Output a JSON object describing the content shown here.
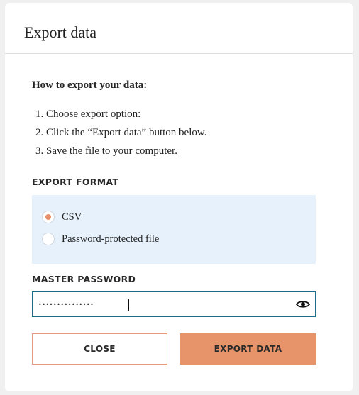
{
  "dialog": {
    "title": "Export data"
  },
  "instructions": {
    "title": "How to export your data:",
    "steps": [
      "1. Choose export option:",
      "2. Click the “Export data” button below.",
      "3. Save the file to your computer."
    ]
  },
  "export_format": {
    "label": "EXPORT FORMAT",
    "options": [
      {
        "label": "CSV",
        "checked": true
      },
      {
        "label": "Password-protected file",
        "checked": false
      }
    ]
  },
  "master_password": {
    "label": "MASTER PASSWORD",
    "value": "•••••••••••••••",
    "eye_icon": "eye-icon"
  },
  "buttons": {
    "close_label": "CLOSE",
    "export_label": "EXPORT DATA"
  },
  "colors": {
    "accent": "#e8946a",
    "format_box_bg": "#e6f1fb",
    "input_border": "#1f6c8a"
  }
}
